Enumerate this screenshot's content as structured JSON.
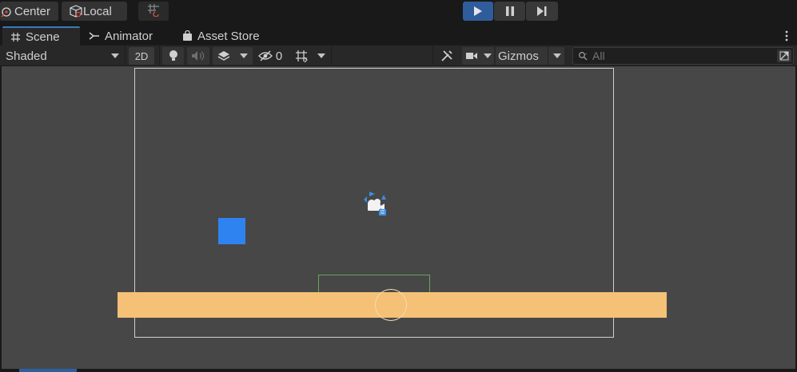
{
  "toolbar": {
    "pivot_label": "Center",
    "space_label": "Local",
    "grid_snap_icon": "grid-snap-icon",
    "play_icon": "play-icon",
    "pause_icon": "pause-icon",
    "step_icon": "step-icon"
  },
  "tabs": [
    {
      "label": "Scene",
      "icon": "hash-icon",
      "active": true
    },
    {
      "label": "Animator",
      "icon": "animator-icon"
    },
    {
      "label": "Asset Store",
      "icon": "bag-icon"
    }
  ],
  "scene_toolbar": {
    "draw_mode": "Shaded",
    "mode_2d": "2D",
    "hidden_count": "0",
    "gizmos_label": "Gizmos",
    "search_placeholder": "All"
  },
  "colors": {
    "accent": "#3a79bb",
    "play_active": "#2f5d9c",
    "viewport_bg": "#474747",
    "ground": "#f4c177",
    "player": "#2f83f0",
    "collider": "#6aa35a"
  }
}
